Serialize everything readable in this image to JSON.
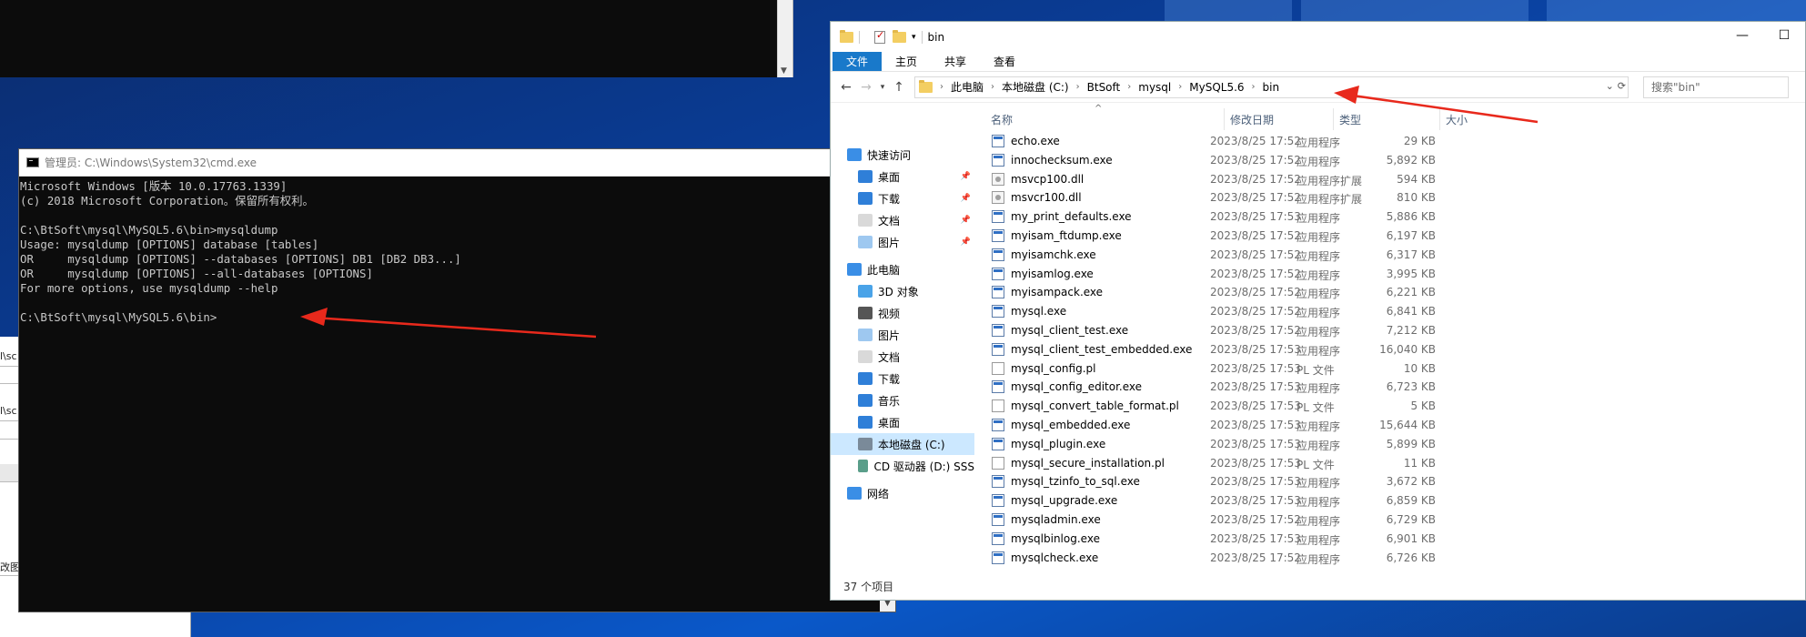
{
  "cmd": {
    "title": "管理员: C:\\Windows\\System32\\cmd.exe",
    "lines": [
      "Microsoft Windows [版本 10.0.17763.1339]",
      "(c) 2018 Microsoft Corporation。保留所有权利。",
      "",
      "C:\\BtSoft\\mysql\\MySQL5.6\\bin>mysqldump",
      "Usage: mysqldump [OPTIONS] database [tables]",
      "OR     mysqldump [OPTIONS] --databases [OPTIONS] DB1 [DB2 DB3...]",
      "OR     mysqldump [OPTIONS] --all-databases [OPTIONS]",
      "For more options, use mysqldump --help",
      "",
      "C:\\BtSoft\\mysql\\MySQL5.6\\bin>"
    ]
  },
  "explorer": {
    "title": "bin",
    "ribbon_tabs": [
      "文件",
      "主页",
      "共享",
      "查看"
    ],
    "breadcrumb": [
      "此电脑",
      "本地磁盘 (C:)",
      "BtSoft",
      "mysql",
      "MySQL5.6",
      "bin"
    ],
    "search_placeholder": "搜索\"bin\"",
    "nav_items": [
      {
        "label": "快速访问",
        "icon": "star-icon"
      },
      {
        "label": "桌面",
        "icon": "desktop-icon",
        "pinned": true
      },
      {
        "label": "下载",
        "icon": "download-icon",
        "pinned": true
      },
      {
        "label": "文档",
        "icon": "document-icon",
        "pinned": true
      },
      {
        "label": "图片",
        "icon": "picture-icon",
        "pinned": true
      },
      {
        "label": "此电脑",
        "icon": "computer-icon"
      },
      {
        "label": "3D 对象",
        "icon": "cube-icon"
      },
      {
        "label": "视频",
        "icon": "video-icon"
      },
      {
        "label": "图片",
        "icon": "picture-icon"
      },
      {
        "label": "文档",
        "icon": "document-icon"
      },
      {
        "label": "下载",
        "icon": "download-icon"
      },
      {
        "label": "音乐",
        "icon": "music-icon"
      },
      {
        "label": "桌面",
        "icon": "desktop-icon"
      },
      {
        "label": "本地磁盘 (C:)",
        "icon": "drive-icon",
        "selected": true
      },
      {
        "label": "CD 驱动器 (D:) SSS",
        "icon": "cd-drive-icon"
      },
      {
        "label": "网络",
        "icon": "network-icon"
      }
    ],
    "columns": [
      "名称",
      "修改日期",
      "类型",
      "大小"
    ],
    "files": [
      {
        "name": "echo.exe",
        "date": "2023/8/25 17:52",
        "type": "应用程序",
        "size": "29 KB",
        "kind": "exe"
      },
      {
        "name": "innochecksum.exe",
        "date": "2023/8/25 17:52",
        "type": "应用程序",
        "size": "5,892 KB",
        "kind": "exe"
      },
      {
        "name": "msvcp100.dll",
        "date": "2023/8/25 17:52",
        "type": "应用程序扩展",
        "size": "594 KB",
        "kind": "dll"
      },
      {
        "name": "msvcr100.dll",
        "date": "2023/8/25 17:52",
        "type": "应用程序扩展",
        "size": "810 KB",
        "kind": "dll"
      },
      {
        "name": "my_print_defaults.exe",
        "date": "2023/8/25 17:53",
        "type": "应用程序",
        "size": "5,886 KB",
        "kind": "exe"
      },
      {
        "name": "myisam_ftdump.exe",
        "date": "2023/8/25 17:52",
        "type": "应用程序",
        "size": "6,197 KB",
        "kind": "exe"
      },
      {
        "name": "myisamchk.exe",
        "date": "2023/8/25 17:52",
        "type": "应用程序",
        "size": "6,317 KB",
        "kind": "exe"
      },
      {
        "name": "myisamlog.exe",
        "date": "2023/8/25 17:52",
        "type": "应用程序",
        "size": "3,995 KB",
        "kind": "exe"
      },
      {
        "name": "myisampack.exe",
        "date": "2023/8/25 17:52",
        "type": "应用程序",
        "size": "6,221 KB",
        "kind": "exe"
      },
      {
        "name": "mysql.exe",
        "date": "2023/8/25 17:52",
        "type": "应用程序",
        "size": "6,841 KB",
        "kind": "exe"
      },
      {
        "name": "mysql_client_test.exe",
        "date": "2023/8/25 17:52",
        "type": "应用程序",
        "size": "7,212 KB",
        "kind": "exe"
      },
      {
        "name": "mysql_client_test_embedded.exe",
        "date": "2023/8/25 17:53",
        "type": "应用程序",
        "size": "16,040 KB",
        "kind": "exe"
      },
      {
        "name": "mysql_config.pl",
        "date": "2023/8/25 17:53",
        "type": "PL 文件",
        "size": "10 KB",
        "kind": "pl"
      },
      {
        "name": "mysql_config_editor.exe",
        "date": "2023/8/25 17:53",
        "type": "应用程序",
        "size": "6,723 KB",
        "kind": "exe"
      },
      {
        "name": "mysql_convert_table_format.pl",
        "date": "2023/8/25 17:53",
        "type": "PL 文件",
        "size": "5 KB",
        "kind": "pl"
      },
      {
        "name": "mysql_embedded.exe",
        "date": "2023/8/25 17:53",
        "type": "应用程序",
        "size": "15,644 KB",
        "kind": "exe"
      },
      {
        "name": "mysql_plugin.exe",
        "date": "2023/8/25 17:53",
        "type": "应用程序",
        "size": "5,899 KB",
        "kind": "exe"
      },
      {
        "name": "mysql_secure_installation.pl",
        "date": "2023/8/25 17:53",
        "type": "PL 文件",
        "size": "11 KB",
        "kind": "pl"
      },
      {
        "name": "mysql_tzinfo_to_sql.exe",
        "date": "2023/8/25 17:53",
        "type": "应用程序",
        "size": "3,672 KB",
        "kind": "exe"
      },
      {
        "name": "mysql_upgrade.exe",
        "date": "2023/8/25 17:53",
        "type": "应用程序",
        "size": "6,859 KB",
        "kind": "exe"
      },
      {
        "name": "mysqladmin.exe",
        "date": "2023/8/25 17:52",
        "type": "应用程序",
        "size": "6,729 KB",
        "kind": "exe"
      },
      {
        "name": "mysqlbinlog.exe",
        "date": "2023/8/25 17:53",
        "type": "应用程序",
        "size": "6,901 KB",
        "kind": "exe"
      },
      {
        "name": "mysqlcheck.exe",
        "date": "2023/8/25 17:52",
        "type": "应用程序",
        "size": "6,726 KB",
        "kind": "exe"
      }
    ],
    "status": "37 个项目"
  },
  "left_window": {
    "fragments": [
      "l\\sc",
      "l\\sc",
      "改图"
    ]
  },
  "colors": {
    "accent": "#1979ca",
    "arrow": "#e8291c",
    "console_bg": "#0c0c0c",
    "console_text": "#c8c8c8"
  }
}
